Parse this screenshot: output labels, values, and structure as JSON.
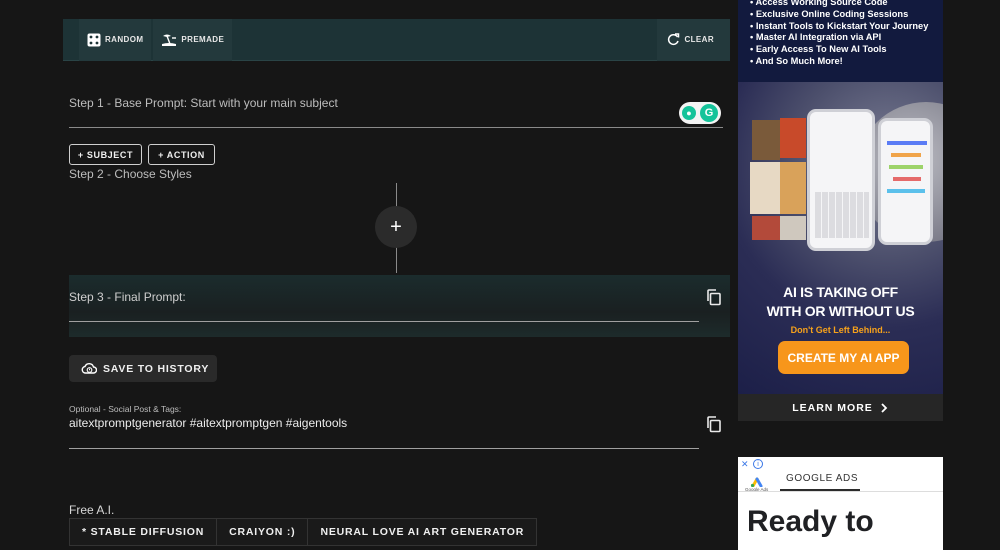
{
  "toolbar": {
    "random_label": "RANDOM",
    "premade_label": "PREMADE",
    "clear_label": "CLEAR"
  },
  "step1": {
    "label": "Step 1 - Base Prompt: Start with your main subject",
    "value": ""
  },
  "chips": {
    "subject": "+ SUBJECT",
    "action": "+ ACTION"
  },
  "step2": {
    "label": "Step 2 - Choose Styles",
    "add_symbol": "+"
  },
  "step3": {
    "label": "Step 3 - Final Prompt:",
    "value": ""
  },
  "save_button": {
    "label": "SAVE TO HISTORY"
  },
  "social": {
    "label": "Optional - Social Post & Tags:",
    "tags": "aitextpromptgenerator #aitextpromptgen #aigentools"
  },
  "free_ai": {
    "label": "Free A.I.",
    "tabs": [
      "* STABLE DIFFUSION",
      "CRAIYON :)",
      "NEURAL LOVE AI ART GENERATOR"
    ]
  },
  "ad_app": {
    "bullets": [
      "Access Working Source Code",
      "Exclusive Online Coding Sessions",
      "Instant Tools to Kickstart Your Journey",
      "Master AI Integration via API",
      "Early Access To New AI Tools",
      "And So Much More!"
    ],
    "headline_1": "AI IS TAKING OFF",
    "headline_2": "WITH OR WITHOUT US",
    "subline": "Don't Get Left Behind...",
    "cta": "CREATE MY AI APP",
    "learn_more": "LEARN MORE"
  },
  "ad_google": {
    "close": "✕",
    "info": "i",
    "brand_small": "Google Ads",
    "tab": "GOOGLE ADS",
    "headline": "Ready to"
  },
  "colors": {
    "toolbar_bg": "#1d3336",
    "cta_orange": "#f7961b",
    "grammarly_green": "#15c39a"
  }
}
